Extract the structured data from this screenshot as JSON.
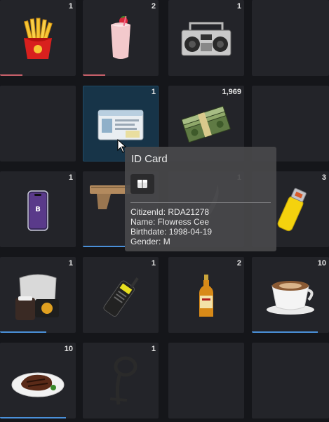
{
  "slots": [
    {
      "id": "fries",
      "count": "1",
      "icon": "french-fries-icon",
      "bar": {
        "color": "#c8606a",
        "fraction": 0.3
      }
    },
    {
      "id": "milkshake",
      "count": "2",
      "icon": "strawberry-milkshake-icon",
      "bar": {
        "color": "#c8606a",
        "fraction": 0.3
      }
    },
    {
      "id": "boombox",
      "count": "1",
      "icon": "boombox-radio-icon"
    },
    {
      "id": "empty-1",
      "count": ""
    },
    {
      "id": "empty-2",
      "count": ""
    },
    {
      "id": "id-card",
      "count": "1",
      "icon": "id-card-icon",
      "selected": true
    },
    {
      "id": "cash",
      "count": "1,969",
      "icon": "cash-stack-icon"
    },
    {
      "id": "empty-3",
      "count": ""
    },
    {
      "id": "phone",
      "count": "1",
      "icon": "smartphone-icon"
    },
    {
      "id": "pistol",
      "count": "",
      "icon": "pistol-icon",
      "bar": {
        "color": "#4a90d9",
        "fraction": 0.55
      }
    },
    {
      "id": "knife",
      "count": "1",
      "icon": "knife-icon"
    },
    {
      "id": "lighter",
      "count": "3",
      "icon": "lighter-icon"
    },
    {
      "id": "takeout",
      "count": "1",
      "icon": "takeout-bag-icon",
      "bar": {
        "color": "#4a90d9",
        "fraction": 0.6
      }
    },
    {
      "id": "radio",
      "count": "1",
      "icon": "walkie-talkie-icon"
    },
    {
      "id": "whiskey",
      "count": "2",
      "icon": "whiskey-bottle-icon"
    },
    {
      "id": "coffee",
      "count": "10",
      "icon": "coffee-cup-icon",
      "bar": {
        "color": "#4a90d9",
        "fraction": 0.85
      }
    },
    {
      "id": "steak",
      "count": "10",
      "icon": "steak-plate-icon",
      "bar": {
        "color": "#4a90d9",
        "fraction": 0.85
      }
    },
    {
      "id": "zip-tie",
      "count": "1",
      "icon": "zip-tie-icon"
    },
    {
      "id": "empty-4",
      "count": ""
    },
    {
      "id": "empty-5",
      "count": ""
    }
  ],
  "tooltip": {
    "title": "ID Card",
    "icon": "package-icon",
    "lines": [
      "CitizenId: RDA21278",
      "Name: Flowress Cee",
      "Birthdate: 1998-04-19",
      "Gender: M"
    ]
  },
  "colors": {
    "background": "#15161a",
    "slot": "#232429",
    "selected": "#173448",
    "accent_blue": "#4a90d9",
    "accent_red": "#c8606a"
  }
}
